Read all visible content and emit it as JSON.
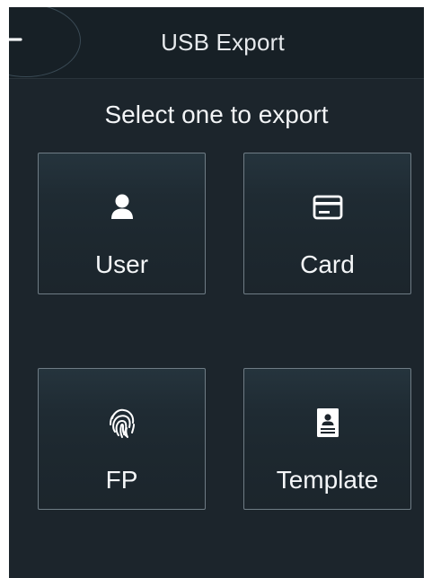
{
  "header": {
    "title": "USB Export",
    "back_icon": "back-arrow-icon"
  },
  "main": {
    "prompt": "Select one to export",
    "options": [
      {
        "label": "User",
        "icon": "user-icon"
      },
      {
        "label": "Card",
        "icon": "card-icon"
      },
      {
        "label": "FP",
        "icon": "fingerprint-icon"
      },
      {
        "label": "Template",
        "icon": "template-icon"
      }
    ]
  },
  "colors": {
    "background": "#1c252c",
    "header_background": "#172026",
    "tile_border": "#6f7c85",
    "text": "#f4f6f8"
  }
}
